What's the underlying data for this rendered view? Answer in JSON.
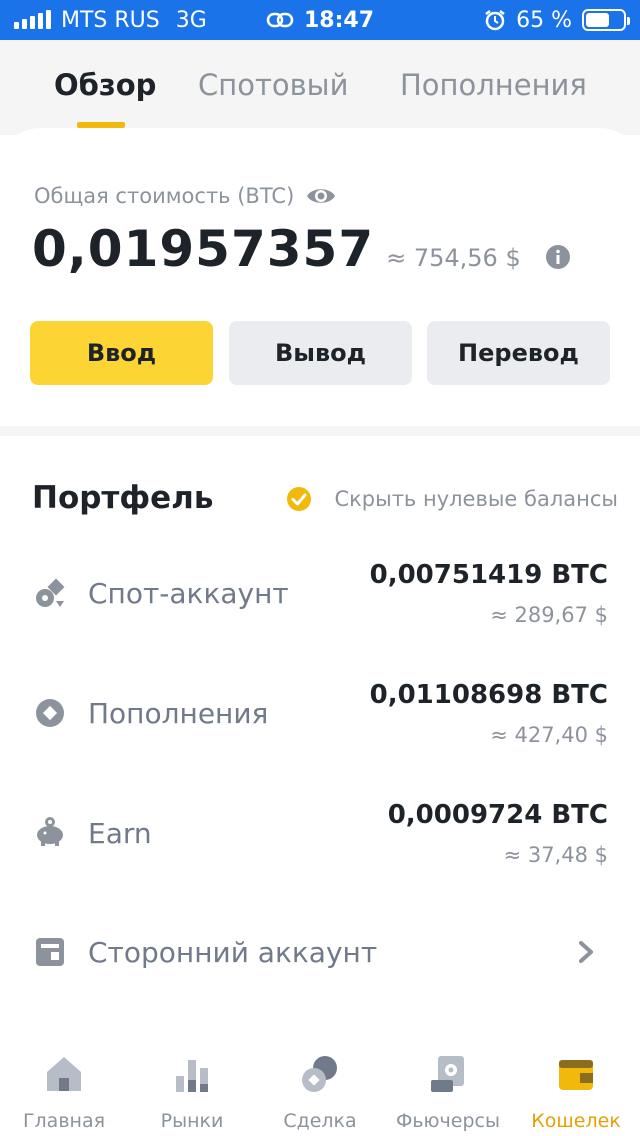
{
  "status_bar": {
    "carrier": "MTS RUS",
    "network": "3G",
    "time": "18:47",
    "battery": "65 %",
    "battery_level": 0.65
  },
  "tabs": [
    {
      "label": "Обзор",
      "active": true
    },
    {
      "label": "Спотовый",
      "active": false
    },
    {
      "label": "Пополнения",
      "active": false
    }
  ],
  "summary": {
    "label": "Общая стоимость (BTC)",
    "amount": "0,01957357",
    "usd": "≈ 754,56 $"
  },
  "actions": {
    "deposit": "Ввод",
    "withdraw": "Вывод",
    "transfer": "Перевод"
  },
  "portfolio": {
    "title": "Портфель",
    "hide_zero": "Скрыть нулевые балансы",
    "accounts": [
      {
        "name": "Спот-аккаунт",
        "amount": "0,00751419 BTC",
        "usd": "≈ 289,67 $",
        "icon": "spot-icon"
      },
      {
        "name": "Пополнения",
        "amount": "0,01108698 BTC",
        "usd": "≈ 427,40 $",
        "icon": "funding-icon"
      },
      {
        "name": "Earn",
        "amount": "0,0009724 BTC",
        "usd": "≈ 37,48 $",
        "icon": "piggy-bank-icon"
      },
      {
        "name": "Сторонний аккаунт",
        "icon": "wallet-card-icon"
      }
    ]
  },
  "bottom_nav": [
    {
      "label": "Главная",
      "icon": "home-icon",
      "active": false
    },
    {
      "label": "Рынки",
      "icon": "markets-icon",
      "active": false
    },
    {
      "label": "Сделка",
      "icon": "trade-icon",
      "active": false
    },
    {
      "label": "Фьючерсы",
      "icon": "futures-icon",
      "active": false
    },
    {
      "label": "Кошелек",
      "icon": "wallet-icon",
      "active": true
    }
  ],
  "colors": {
    "accent": "#fcd535",
    "accent_text": "#e7a007",
    "status_bar": "#1a73e8",
    "muted": "#8d939c"
  }
}
